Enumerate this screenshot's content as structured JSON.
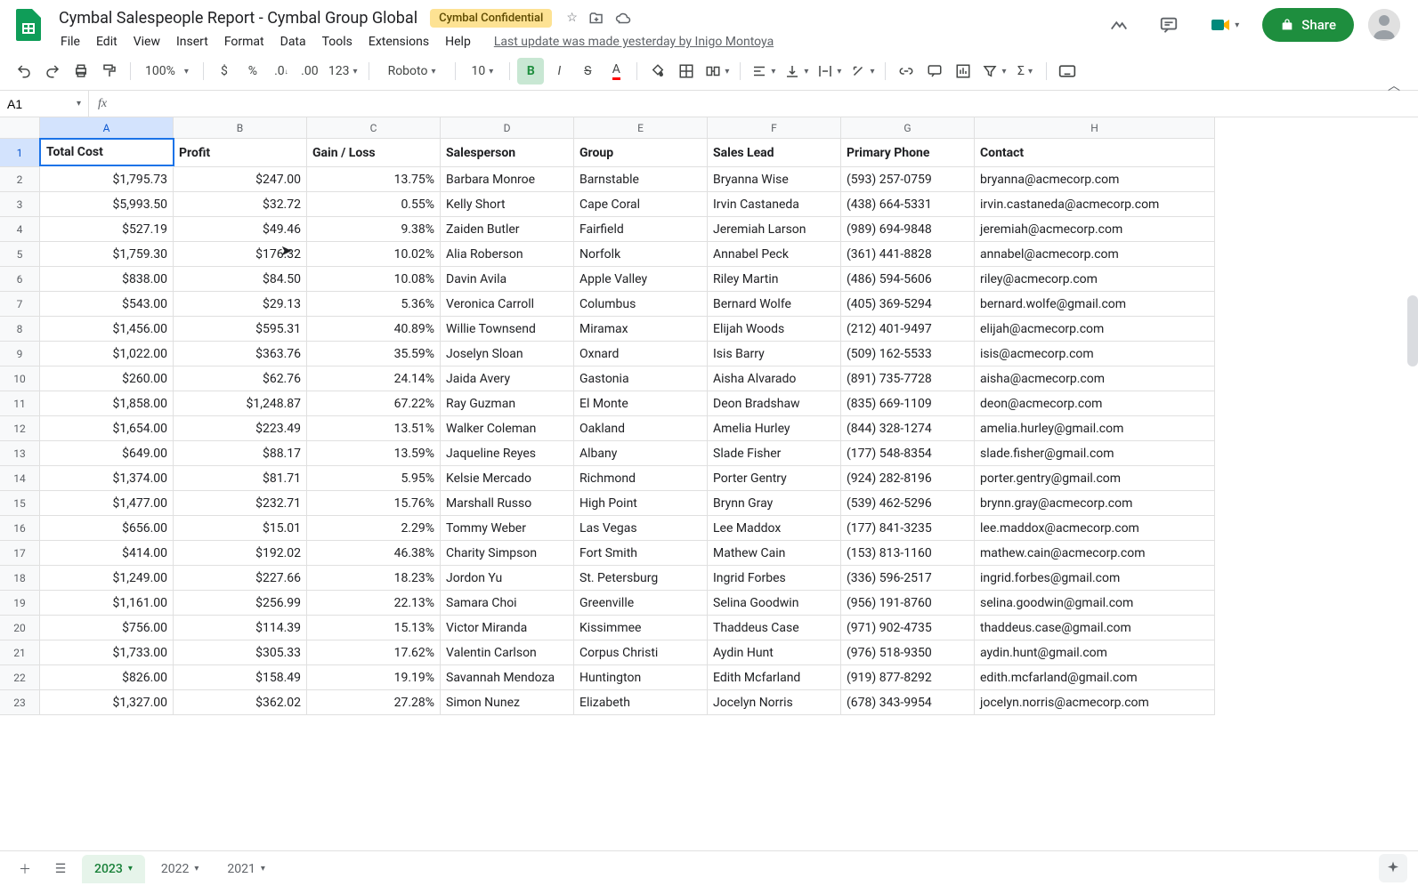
{
  "doc": {
    "title": "Cymbal Salespeople Report - Cymbal Group Global",
    "badge": "Cymbal Confidential",
    "last_update": "Last update was made yesterday by Inigo Montoya"
  },
  "menu": [
    "File",
    "Edit",
    "View",
    "Insert",
    "Format",
    "Data",
    "Tools",
    "Extensions",
    "Help"
  ],
  "toolbar": {
    "zoom": "100%",
    "font": "Roboto",
    "size": "10"
  },
  "share_label": "Share",
  "namebox": "A1",
  "formula": "",
  "columns": [
    "A",
    "B",
    "C",
    "D",
    "E",
    "F",
    "G",
    "H"
  ],
  "headers": [
    "Total Cost",
    "Profit",
    "Gain / Loss",
    "Salesperson",
    "Group",
    "Sales Lead",
    "Primary Phone",
    "Contact"
  ],
  "rows": [
    {
      "n": 2,
      "total": "$1,795.73",
      "profit": "$247.00",
      "gl": "13.75%",
      "sp": "Barbara Monroe",
      "grp": "Barnstable",
      "lead": "Bryanna Wise",
      "phone": "(593) 257-0759",
      "contact": "bryanna@acmecorp.com"
    },
    {
      "n": 3,
      "total": "$5,993.50",
      "profit": "$32.72",
      "gl": "0.55%",
      "sp": "Kelly Short",
      "grp": "Cape Coral",
      "lead": "Irvin Castaneda",
      "phone": "(438) 664-5331",
      "contact": "irvin.castaneda@acmecorp.com"
    },
    {
      "n": 4,
      "total": "$527.19",
      "profit": "$49.46",
      "gl": "9.38%",
      "sp": "Zaiden Butler",
      "grp": "Fairfield",
      "lead": "Jeremiah Larson",
      "phone": "(989) 694-9848",
      "contact": "jeremiah@acmecorp.com"
    },
    {
      "n": 5,
      "total": "$1,759.30",
      "profit": "$176.32",
      "gl": "10.02%",
      "sp": "Alia Roberson",
      "grp": "Norfolk",
      "lead": "Annabel Peck",
      "phone": "(361) 441-8828",
      "contact": "annabel@acmecorp.com"
    },
    {
      "n": 6,
      "total": "$838.00",
      "profit": "$84.50",
      "gl": "10.08%",
      "sp": "Davin Avila",
      "grp": "Apple Valley",
      "lead": "Riley Martin",
      "phone": "(486) 594-5606",
      "contact": "riley@acmecorp.com"
    },
    {
      "n": 7,
      "total": "$543.00",
      "profit": "$29.13",
      "gl": "5.36%",
      "sp": "Veronica Carroll",
      "grp": "Columbus",
      "lead": "Bernard Wolfe",
      "phone": "(405) 369-5294",
      "contact": "bernard.wolfe@gmail.com"
    },
    {
      "n": 8,
      "total": "$1,456.00",
      "profit": "$595.31",
      "gl": "40.89%",
      "sp": "Willie Townsend",
      "grp": "Miramax",
      "lead": "Elijah Woods",
      "phone": "(212) 401-9497",
      "contact": "elijah@acmecorp.com"
    },
    {
      "n": 9,
      "total": "$1,022.00",
      "profit": "$363.76",
      "gl": "35.59%",
      "sp": "Joselyn Sloan",
      "grp": "Oxnard",
      "lead": "Isis Barry",
      "phone": "(509) 162-5533",
      "contact": "isis@acmecorp.com"
    },
    {
      "n": 10,
      "total": "$260.00",
      "profit": "$62.76",
      "gl": "24.14%",
      "sp": "Jaida Avery",
      "grp": "Gastonia",
      "lead": "Aisha Alvarado",
      "phone": "(891) 735-7728",
      "contact": "aisha@acmecorp.com"
    },
    {
      "n": 11,
      "total": "$1,858.00",
      "profit": "$1,248.87",
      "gl": "67.22%",
      "sp": "Ray Guzman",
      "grp": "El Monte",
      "lead": "Deon Bradshaw",
      "phone": "(835) 669-1109",
      "contact": "deon@acmecorp.com"
    },
    {
      "n": 12,
      "total": "$1,654.00",
      "profit": "$223.49",
      "gl": "13.51%",
      "sp": "Walker Coleman",
      "grp": "Oakland",
      "lead": "Amelia Hurley",
      "phone": "(844) 328-1274",
      "contact": "amelia.hurley@gmail.com"
    },
    {
      "n": 13,
      "total": "$649.00",
      "profit": "$88.17",
      "gl": "13.59%",
      "sp": "Jaqueline Reyes",
      "grp": "Albany",
      "lead": "Slade Fisher",
      "phone": "(177) 548-8354",
      "contact": "slade.fisher@gmail.com"
    },
    {
      "n": 14,
      "total": "$1,374.00",
      "profit": "$81.71",
      "gl": "5.95%",
      "sp": "Kelsie Mercado",
      "grp": "Richmond",
      "lead": "Porter Gentry",
      "phone": "(924) 282-8196",
      "contact": "porter.gentry@gmail.com"
    },
    {
      "n": 15,
      "total": "$1,477.00",
      "profit": "$232.71",
      "gl": "15.76%",
      "sp": "Marshall Russo",
      "grp": "High Point",
      "lead": "Brynn Gray",
      "phone": "(539) 462-5296",
      "contact": "brynn.gray@acmecorp.com"
    },
    {
      "n": 16,
      "total": "$656.00",
      "profit": "$15.01",
      "gl": "2.29%",
      "sp": "Tommy Weber",
      "grp": "Las Vegas",
      "lead": "Lee Maddox",
      "phone": "(177) 841-3235",
      "contact": "lee.maddox@acmecorp.com"
    },
    {
      "n": 17,
      "total": "$414.00",
      "profit": "$192.02",
      "gl": "46.38%",
      "sp": "Charity Simpson",
      "grp": "Fort Smith",
      "lead": "Mathew Cain",
      "phone": "(153) 813-1160",
      "contact": "mathew.cain@acmecorp.com"
    },
    {
      "n": 18,
      "total": "$1,249.00",
      "profit": "$227.66",
      "gl": "18.23%",
      "sp": "Jordon Yu",
      "grp": "St. Petersburg",
      "lead": "Ingrid Forbes",
      "phone": "(336) 596-2517",
      "contact": "ingrid.forbes@gmail.com"
    },
    {
      "n": 19,
      "total": "$1,161.00",
      "profit": "$256.99",
      "gl": "22.13%",
      "sp": "Samara Choi",
      "grp": "Greenville",
      "lead": "Selina Goodwin",
      "phone": "(956) 191-8760",
      "contact": "selina.goodwin@gmail.com"
    },
    {
      "n": 20,
      "total": "$756.00",
      "profit": "$114.39",
      "gl": "15.13%",
      "sp": "Victor Miranda",
      "grp": "Kissimmee",
      "lead": "Thaddeus Case",
      "phone": "(971) 902-4735",
      "contact": "thaddeus.case@gmail.com"
    },
    {
      "n": 21,
      "total": "$1,733.00",
      "profit": "$305.33",
      "gl": "17.62%",
      "sp": "Valentin Carlson",
      "grp": "Corpus Christi",
      "lead": "Aydin Hunt",
      "phone": "(976) 518-9350",
      "contact": "aydin.hunt@gmail.com"
    },
    {
      "n": 22,
      "total": "$826.00",
      "profit": "$158.49",
      "gl": "19.19%",
      "sp": "Savannah Mendoza",
      "grp": "Huntington",
      "lead": "Edith Mcfarland",
      "phone": "(919) 877-8292",
      "contact": "edith.mcfarland@gmail.com"
    },
    {
      "n": 23,
      "total": "$1,327.00",
      "profit": "$362.02",
      "gl": "27.28%",
      "sp": "Simon Nunez",
      "grp": "Elizabeth",
      "lead": "Jocelyn Norris",
      "phone": "(678) 343-9954",
      "contact": "jocelyn.norris@acmecorp.com"
    }
  ],
  "sheets": [
    {
      "name": "2023",
      "active": true
    },
    {
      "name": "2022",
      "active": false
    },
    {
      "name": "2021",
      "active": false
    }
  ]
}
